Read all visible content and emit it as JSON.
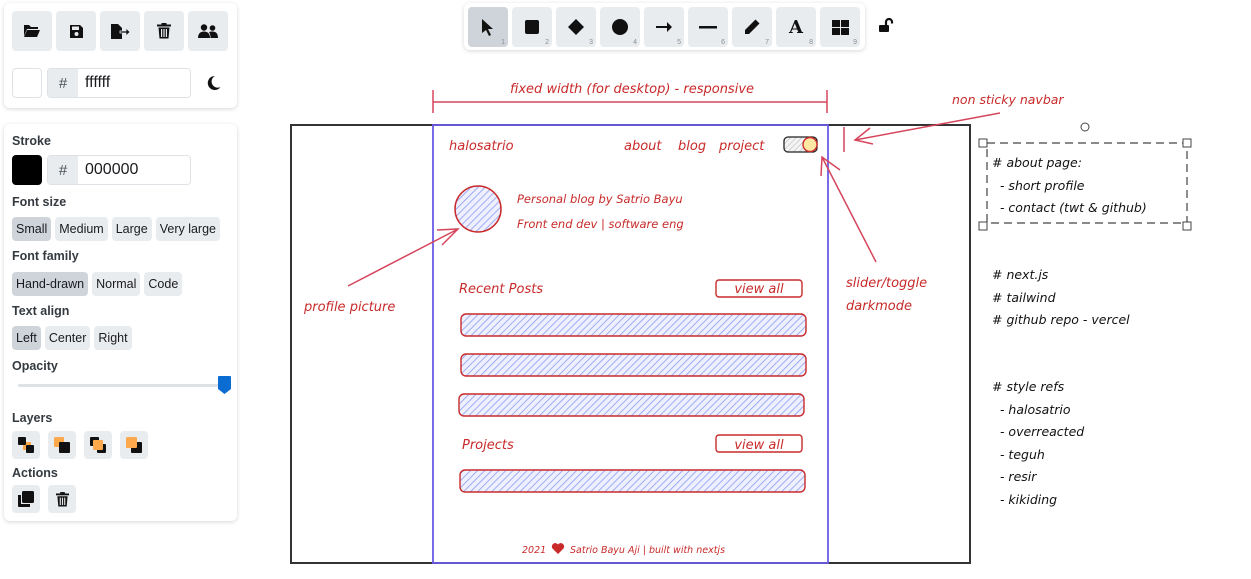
{
  "colors": {
    "accent_red": "#c92a2a",
    "wireframe_purple": "#6c5ce7",
    "hatch_blue": "#a5b4fc",
    "slider_blue": "#0b6cd1",
    "layer_orange": "#ffa94d"
  },
  "file_panel": {
    "buttons": [
      {
        "name": "open-icon",
        "label": "Open"
      },
      {
        "name": "save-icon",
        "label": "Save"
      },
      {
        "name": "export-icon",
        "label": "Export"
      },
      {
        "name": "trash-icon",
        "label": "Clear canvas"
      },
      {
        "name": "collab-icon",
        "label": "Live collaboration"
      }
    ],
    "background_hash": "#",
    "background_value": "ffffff",
    "background_swatch": "#ffffff",
    "theme_toggle_icon": "moon-icon"
  },
  "properties": {
    "stroke_label": "Stroke",
    "stroke_hash": "#",
    "stroke_value": "000000",
    "stroke_swatch": "#000000",
    "font_size_label": "Font size",
    "font_sizes": [
      "Small",
      "Medium",
      "Large",
      "Very large"
    ],
    "font_size_selected": "Small",
    "font_family_label": "Font family",
    "font_families": [
      "Hand-drawn",
      "Normal",
      "Code"
    ],
    "font_family_selected": "Hand-drawn",
    "text_align_label": "Text align",
    "text_aligns": [
      "Left",
      "Center",
      "Right"
    ],
    "text_align_selected": "Left",
    "opacity_label": "Opacity",
    "opacity_value_percent": 100,
    "layers_label": "Layers",
    "layers": [
      "send-to-back",
      "send-backward",
      "bring-forward",
      "bring-to-front"
    ],
    "actions_label": "Actions",
    "actions": [
      "duplicate",
      "delete"
    ]
  },
  "toolbar": {
    "tools": [
      {
        "name": "selection",
        "shortcut": "1",
        "active": true
      },
      {
        "name": "rectangle",
        "shortcut": "2"
      },
      {
        "name": "diamond",
        "shortcut": "3"
      },
      {
        "name": "ellipse",
        "shortcut": "4"
      },
      {
        "name": "arrow",
        "shortcut": "5"
      },
      {
        "name": "line",
        "shortcut": "6"
      },
      {
        "name": "draw",
        "shortcut": "7"
      },
      {
        "name": "text",
        "shortcut": "8",
        "glyph": "A"
      },
      {
        "name": "library",
        "shortcut": "9"
      }
    ],
    "lock_state": "unlocked"
  },
  "sketch": {
    "width_annotation": "fixed width (for desktop) - responsive",
    "navbar_annotation": "non sticky navbar",
    "nav": {
      "brand": "halosatrio",
      "links": [
        "about",
        "blog",
        "project"
      ]
    },
    "profile": {
      "line1": "Personal blog by Satrio Bayu",
      "line2": "Front end dev | software eng"
    },
    "profile_annotation": "profile picture",
    "toggle_annotation_line1": "slider/toggle",
    "toggle_annotation_line2": "darkmode",
    "recent_posts_title": "Recent Posts",
    "projects_title": "Projects",
    "view_all": "view all",
    "footer_year": "2021",
    "footer_text": "Satrio Bayu Aji | built with nextjs",
    "notes_about": [
      "# about page:",
      "  - short profile",
      "  - contact (twt & github)"
    ],
    "notes_stack": [
      "# next.js",
      "# tailwind",
      "# github repo - vercel"
    ],
    "notes_style": [
      "# style refs",
      "  - halosatrio",
      "  - overreacted",
      "  - teguh",
      "  - resir",
      "  - kikiding"
    ]
  }
}
